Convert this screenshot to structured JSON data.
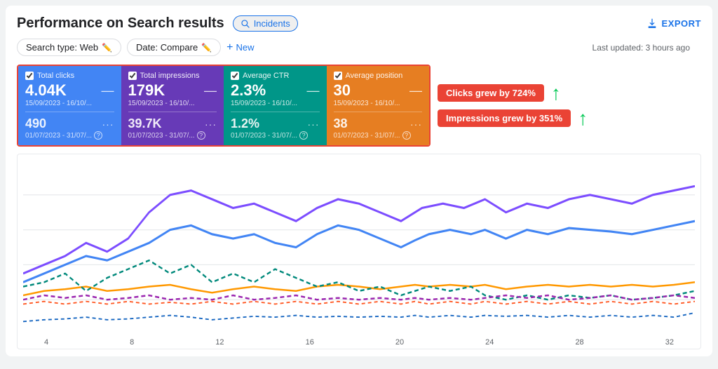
{
  "header": {
    "title": "Performance on Search results",
    "incidents_label": "Incidents",
    "export_label": "EXPORT"
  },
  "filters": {
    "search_type_label": "Search type: Web",
    "date_label": "Date: Compare",
    "new_label": "New",
    "last_updated": "Last updated: 3 hours ago"
  },
  "metrics": [
    {
      "id": "clicks",
      "label": "Total clicks",
      "value": "4.04K",
      "date": "15/09/2023 - 16/10/...",
      "compare_value": "490",
      "compare_date": "01/07/2023 - 31/07/..."
    },
    {
      "id": "impressions",
      "label": "Total impressions",
      "value": "179K",
      "date": "15/09/2023 - 16/10/...",
      "compare_value": "39.7K",
      "compare_date": "01/07/2023 - 31/07/..."
    },
    {
      "id": "ctr",
      "label": "Average CTR",
      "value": "2.3%",
      "date": "15/09/2023 - 16/10/...",
      "compare_value": "1.2%",
      "compare_date": "01/07/2023 - 31/07/..."
    },
    {
      "id": "position",
      "label": "Average position",
      "value": "30",
      "date": "15/09/2023 - 16/10/...",
      "compare_value": "38",
      "compare_date": "01/07/2023 - 31/07/..."
    }
  ],
  "annotations": [
    {
      "id": "clicks-annotation",
      "text": "Clicks grew by 724%",
      "badge_class": "clicks-badge"
    },
    {
      "id": "impressions-annotation",
      "text": "Impressions grew by 351%",
      "badge_class": "impressions-badge"
    }
  ],
  "chart": {
    "x_labels": [
      "4",
      "8",
      "12",
      "16",
      "20",
      "24",
      "28",
      "32"
    ]
  }
}
